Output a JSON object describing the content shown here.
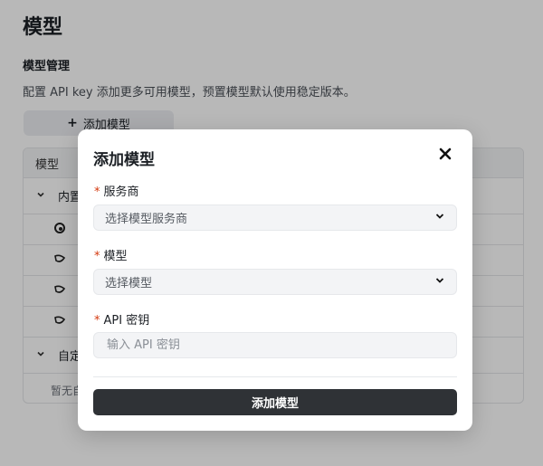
{
  "page": {
    "title": "模型",
    "section_title": "模型管理",
    "section_desc": "配置 API key 添加更多可用模型，预置模型默认使用稳定版本。",
    "add_button_label": "添加模型"
  },
  "table": {
    "header": "模型",
    "groups": [
      {
        "label": "内置"
      },
      {
        "label": "自定"
      }
    ],
    "empty_text": "暂无自"
  },
  "modal": {
    "title": "添加模型",
    "fields": {
      "provider": {
        "label": "服务商",
        "placeholder": "选择模型服务商"
      },
      "model": {
        "label": "模型",
        "placeholder": "选择模型"
      },
      "api_key": {
        "label": "API 密钥",
        "placeholder": "输入 API 密钥"
      }
    },
    "required_mark": "*",
    "submit_label": "添加模型"
  }
}
